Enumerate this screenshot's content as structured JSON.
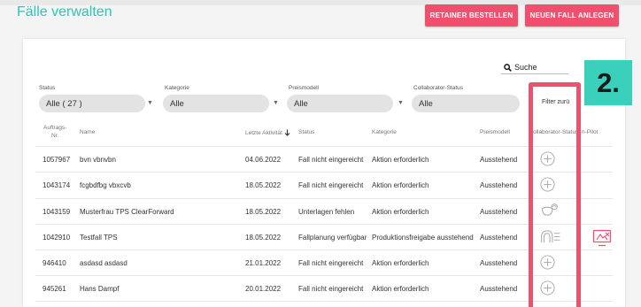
{
  "page": {
    "title": "Fälle verwalten"
  },
  "toolbar": {
    "retainer_label": "RETAINER BESTELLEN",
    "newcase_label": "NEUEN FALL ANLEGEN"
  },
  "search": {
    "label": "Suche",
    "icon": "search-icon"
  },
  "filters": [
    {
      "label": "Status",
      "value": "Alle ( 27 )"
    },
    {
      "label": "Kategorie",
      "value": "Alle"
    },
    {
      "label": "Preismodell",
      "value": "Alle"
    },
    {
      "label": "Collaborator-Status",
      "value": "Alle"
    }
  ],
  "collab_filter": {
    "value": "Filter zurü"
  },
  "step_badge": "2.",
  "table": {
    "headers": {
      "order_no_line1": "Auftrags-",
      "order_no_line2": "Nr.",
      "name": "Name",
      "last_activity": "Letzte Aktivität",
      "sort_icon": "arrow-down-icon",
      "status": "Status",
      "category": "Kategorie",
      "price_model": "Preismodell",
      "collab_status": "ollaborator-Status",
      "pilot": "n-Pilot"
    },
    "rows": [
      {
        "order_no": "1057967",
        "name": "bvn vbnvbn",
        "date": "04.06.2022",
        "status": "Fall nicht eingereicht",
        "category": "Aktion erforderlich",
        "price": "Ausstehend",
        "collab_icon": "plus-circle-icon"
      },
      {
        "order_no": "1043174",
        "name": "fcgbdfbg vbxcvb",
        "date": "18.05.2022",
        "status": "Fall nicht eingereicht",
        "category": "Aktion erforderlich",
        "price": "Ausstehend",
        "collab_icon": "plus-circle-icon"
      },
      {
        "order_no": "1043159",
        "name": "Musterfrau TPS ClearForward",
        "date": "18.05.2022",
        "status": "Unterlagen fehlen",
        "category": "Aktion erforderlich",
        "price": "Ausstehend",
        "collab_icon": "aligner-icon"
      },
      {
        "order_no": "1042910",
        "name": "Testfall TPS",
        "date": "18.05.2022",
        "status": "Fallplanung verfügbar",
        "category": "Produktionsfreigabe ausstehend",
        "price": "Ausstehend",
        "collab_icon": "arch-list-icon",
        "pilot_icon": "pilot-screen-icon"
      },
      {
        "order_no": "946410",
        "name": "asdasd asdasd",
        "date": "21.01.2022",
        "status": "Fall nicht eingereicht",
        "category": "Aktion erforderlich",
        "price": "Ausstehend",
        "collab_icon": "plus-circle-icon"
      },
      {
        "order_no": "945261",
        "name": "Hans Dampf",
        "date": "20.01.2022",
        "status": "Fall nicht eingereicht",
        "category": "Aktion erforderlich",
        "price": "Ausstehend",
        "collab_icon": "plus-circle-icon"
      }
    ]
  },
  "colors": {
    "accent_teal": "#2ec4b6",
    "button_pink": "#f0506e",
    "badge_teal": "#3ad0bc",
    "select_grey": "#e3e3e3"
  }
}
